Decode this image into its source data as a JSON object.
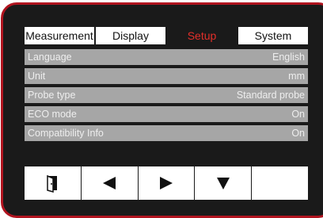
{
  "tabs": [
    {
      "label": "Measurement",
      "active": false
    },
    {
      "label": "Display",
      "active": false
    },
    {
      "label": "Setup",
      "active": true
    },
    {
      "label": "System",
      "active": false
    }
  ],
  "settings": [
    {
      "label": "Language",
      "value": "English"
    },
    {
      "label": "Unit",
      "value": "mm"
    },
    {
      "label": "Probe type",
      "value": "Standard probe"
    },
    {
      "label": "ECO mode",
      "value": "On"
    },
    {
      "label": "Compatibility Info",
      "value": "On"
    }
  ],
  "buttons": [
    {
      "icon": "exit-door-icon"
    },
    {
      "icon": "arrow-left-icon"
    },
    {
      "icon": "arrow-right-icon"
    },
    {
      "icon": "arrow-down-icon"
    },
    {
      "icon": "none"
    }
  ],
  "colors": {
    "frame": "#b0141f",
    "screen_bg": "#1a1a1a",
    "active_tab_text": "#e32f2a",
    "row_bg": "#a6a6a6",
    "row_text": "#eeeeee"
  }
}
